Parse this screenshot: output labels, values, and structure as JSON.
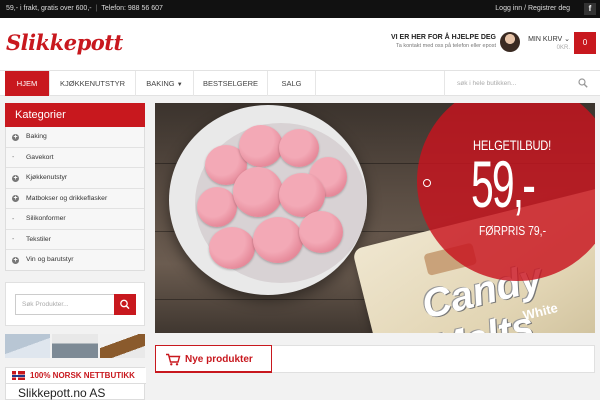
{
  "topbar": {
    "shipping": "59,- i frakt, gratis over 600,-",
    "phone": "Telefon: 988 56 607",
    "account": "Logg inn / Registrer deg",
    "fb": "f"
  },
  "header": {
    "logo": "Slikkepott",
    "help_title": "VI ER HER FOR Å HJELPE DEG",
    "help_sub": "Ta kontakt med oss på telefon eller epost",
    "cart_label": "MIN KURV",
    "cart_total": "0KR.",
    "cart_count": "0"
  },
  "nav": {
    "items": [
      "HJEM",
      "KJØKKENUTSTYR",
      "BAKING",
      "BESTSELGERE",
      "SALG"
    ],
    "search_placeholder": "søk i hele butikken..."
  },
  "sidebar": {
    "title": "Kategorier",
    "categories": [
      {
        "label": "Baking",
        "marker": "+"
      },
      {
        "label": "Gavekort",
        "marker": "-"
      },
      {
        "label": "Kjøkkenutstyr",
        "marker": "+"
      },
      {
        "label": "Matbokser og drikkeflasker",
        "marker": "+"
      },
      {
        "label": "Silikonformer",
        "marker": "-"
      },
      {
        "label": "Tekstiler",
        "marker": "-"
      },
      {
        "label": "Vin og barutstyr",
        "marker": "+"
      }
    ],
    "search_placeholder": "Søk Produkter...",
    "promo_banner": "100% NORSK NETTBUTIKK",
    "promo_company": "Slikkepott.no AS"
  },
  "hero": {
    "title": "HELGETILBUD!",
    "price": "59,-",
    "was": "FØRPRIS 79,-",
    "product_brand": "Candy Melts",
    "product_variant": "White"
  },
  "new_products": {
    "label": "Nye produkter"
  },
  "colors": {
    "accent": "#c8181e",
    "topbar": "#111111"
  }
}
